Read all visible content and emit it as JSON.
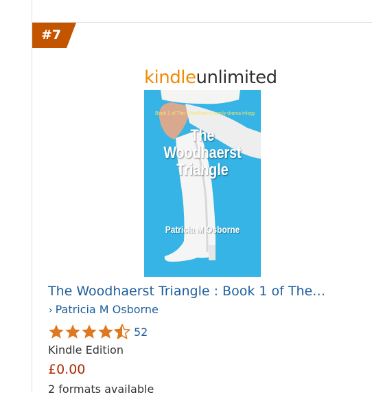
{
  "rank": {
    "label": "#7",
    "badge_color": "#c45500"
  },
  "kindle_unlimited": {
    "part1": "kindle",
    "part2": "unlimited",
    "color_kindle": "#f18a00"
  },
  "cover": {
    "subtitle": "Book 1 of The Woodhaerst family drama trilogy",
    "title_line1": "The",
    "title_line2": "Woodhaerst",
    "title_line3": "Triangle",
    "author": "Patricia M Osborne",
    "background": "#33b3e4"
  },
  "product": {
    "title": "The Woodhaerst Triangle : Book 1 of The…",
    "author_chevron": "›",
    "author": "Patricia M Osborne",
    "rating_stars": 4.5,
    "rating_max": 5,
    "rating_count": "52",
    "format": "Kindle Edition",
    "price": "£0.00",
    "formats_available": "2 formats available",
    "link_color": "#1e5e9c",
    "price_color": "#b12704",
    "star_color": "#de7921"
  }
}
